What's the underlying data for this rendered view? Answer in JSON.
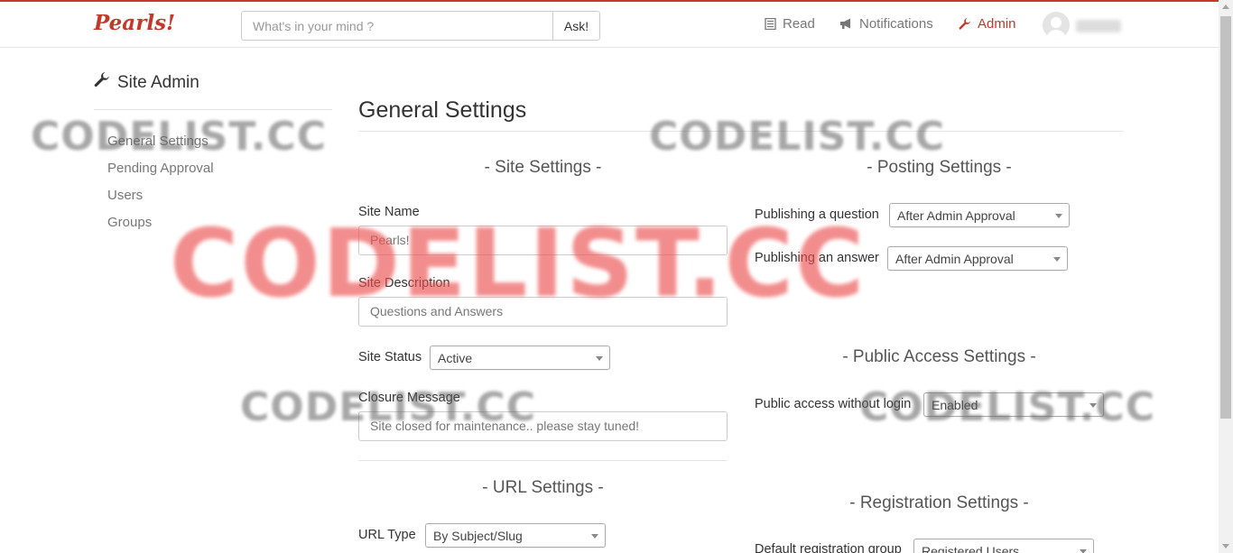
{
  "app": {
    "brand": "Pearls!"
  },
  "search": {
    "placeholder": "What's in your mind ?",
    "button_label": "Ask!"
  },
  "nav": {
    "read": "Read",
    "notifications": "Notifications",
    "admin": "Admin",
    "accent_color": "#c0392b"
  },
  "sidebar": {
    "title": "Site Admin",
    "items": [
      {
        "label": "General Settings"
      },
      {
        "label": "Pending Approval"
      },
      {
        "label": "Users"
      },
      {
        "label": "Groups"
      }
    ]
  },
  "main": {
    "title": "General Settings",
    "site_settings": {
      "heading": "- Site Settings -",
      "site_name_label": "Site Name",
      "site_name_value": "Pearls!",
      "site_description_label": "Site Description",
      "site_description_value": "Questions and Answers",
      "site_status_label": "Site Status",
      "site_status_value": "Active",
      "closure_message_label": "Closure Message",
      "closure_message_value": "Site closed for maintenance.. please stay tuned!"
    },
    "url_settings": {
      "heading": "- URL Settings -",
      "url_type_label": "URL Type",
      "url_type_value": "By Subject/Slug"
    },
    "posting_settings": {
      "heading": "- Posting Settings -",
      "question_label": "Publishing a question",
      "question_value": "After Admin Approval",
      "answer_label": "Publishing an answer",
      "answer_value": "After Admin Approval"
    },
    "public_access_settings": {
      "heading": "- Public Access Settings -",
      "access_label": "Public access without login",
      "access_value": "Enabled"
    },
    "registration_settings": {
      "heading": "- Registration Settings -",
      "default_group_label": "Default registration group",
      "default_group_value": "Registered Users"
    }
  },
  "watermarks": {
    "small": "CODELIST.CC",
    "big": "CODELIST.CC"
  }
}
